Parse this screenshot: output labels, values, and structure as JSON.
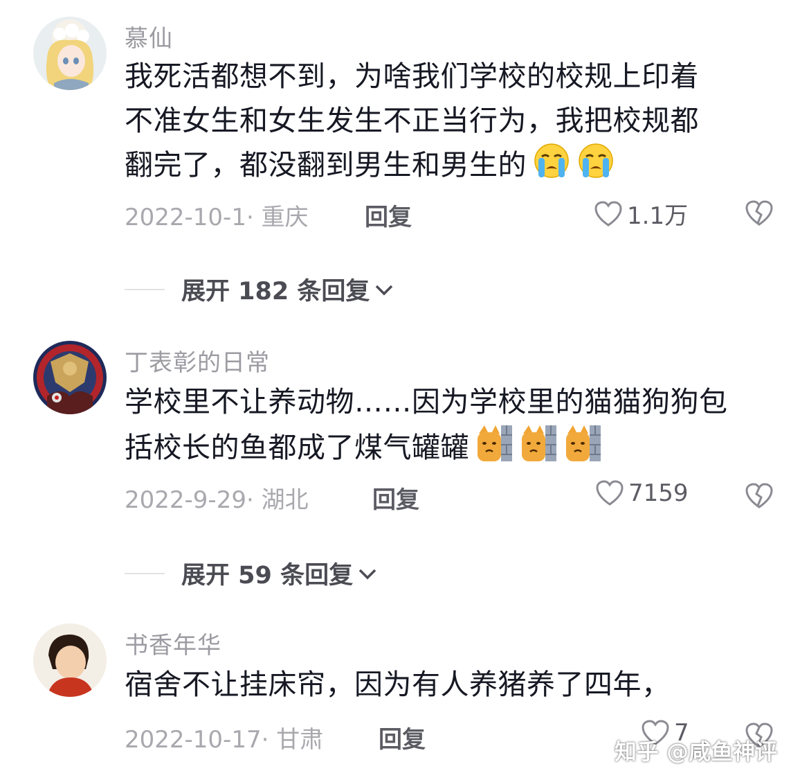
{
  "comments": [
    {
      "username": "慕仙",
      "text_lines": [
        "我死活都想不到，为啥我们学校的校规上印着",
        "不准女生和女生发生不正当行为，我把校规都",
        "翻完了，都没翻到男生和男生的"
      ],
      "emoji": "loudly-crying-emoji",
      "emoji_count": 2,
      "date_location": "2022-10-1· 重庆",
      "reply_label": "回复",
      "likes": "1.1万",
      "expand_label": "展开 182 条回复"
    },
    {
      "username": "丁表彰的日常",
      "text_lines": [
        "学校里不让养动物……因为学校里的猫猫狗狗包",
        "括校长的鱼都成了煤气罐罐"
      ],
      "emoji": "cat-behind-wall-emoji",
      "emoji_count": 3,
      "date_location": "2022-9-29· 湖北",
      "reply_label": "回复",
      "likes": "7159",
      "expand_label": "展开 59 条回复"
    },
    {
      "username": "书香年华",
      "text_lines": [
        "宿舍不让挂床帘，因为有人养猪养了四年，"
      ],
      "date_location": "2022-10-17· 甘肃",
      "reply_label": "回复",
      "likes": "7"
    }
  ],
  "watermark": "知乎 @咸鱼神评",
  "colors": {
    "username": "#9b9ba2",
    "text": "#161823",
    "meta": "#a8a8ae",
    "reply": "#5b5b63"
  }
}
